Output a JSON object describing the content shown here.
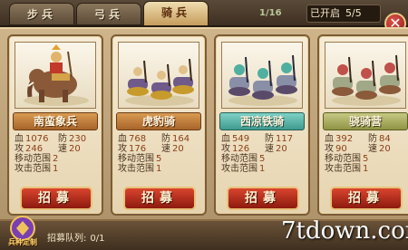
{
  "tabs": [
    {
      "label": "步兵",
      "active": false
    },
    {
      "label": "弓兵",
      "active": false
    },
    {
      "label": "骑兵",
      "active": true
    }
  ],
  "header": {
    "progress_text": "1/16",
    "opened_label": "已开启",
    "opened_value": "5/5"
  },
  "close_icon": "close-x-icon",
  "units": [
    {
      "name": "南蛮象兵",
      "hp_label": "血",
      "hp": "1076",
      "def_label": "防",
      "def": "230",
      "atk_label": "攻",
      "atk": "246",
      "spd_label": "速",
      "spd": "20",
      "move_label": "移动范围",
      "move": "2",
      "range_label": "攻击范围",
      "range": "1",
      "recruit_label": "招募",
      "name_color": "#a7652a"
    },
    {
      "name": "虎豹骑",
      "hp_label": "血",
      "hp": "768",
      "def_label": "防",
      "def": "164",
      "atk_label": "攻",
      "atk": "176",
      "spd_label": "速",
      "spd": "20",
      "move_label": "移动范围",
      "move": "5",
      "range_label": "攻击范围",
      "range": "1",
      "recruit_label": "招募",
      "name_color": "#a7652a"
    },
    {
      "name": "西凉铁骑",
      "hp_label": "血",
      "hp": "549",
      "def_label": "防",
      "def": "117",
      "atk_label": "攻",
      "atk": "126",
      "spd_label": "速",
      "spd": "20",
      "move_label": "移动范围",
      "move": "5",
      "range_label": "攻击范围",
      "range": "1",
      "recruit_label": "招募",
      "name_color": "#3f9a8e"
    },
    {
      "name": "骁骑营",
      "hp_label": "血",
      "hp": "392",
      "def_label": "防",
      "def": "84",
      "atk_label": "攻",
      "atk": "90",
      "spd_label": "速",
      "spd": "20",
      "move_label": "移动范围",
      "move": "5",
      "range_label": "攻击范围",
      "range": "1",
      "recruit_label": "招募",
      "name_color": "#8f9444"
    }
  ],
  "footer": {
    "emblem_text": "兵种定制",
    "queue_label": "招募队列:",
    "queue_value": "0/1",
    "watermark": "7tdown.com"
  }
}
